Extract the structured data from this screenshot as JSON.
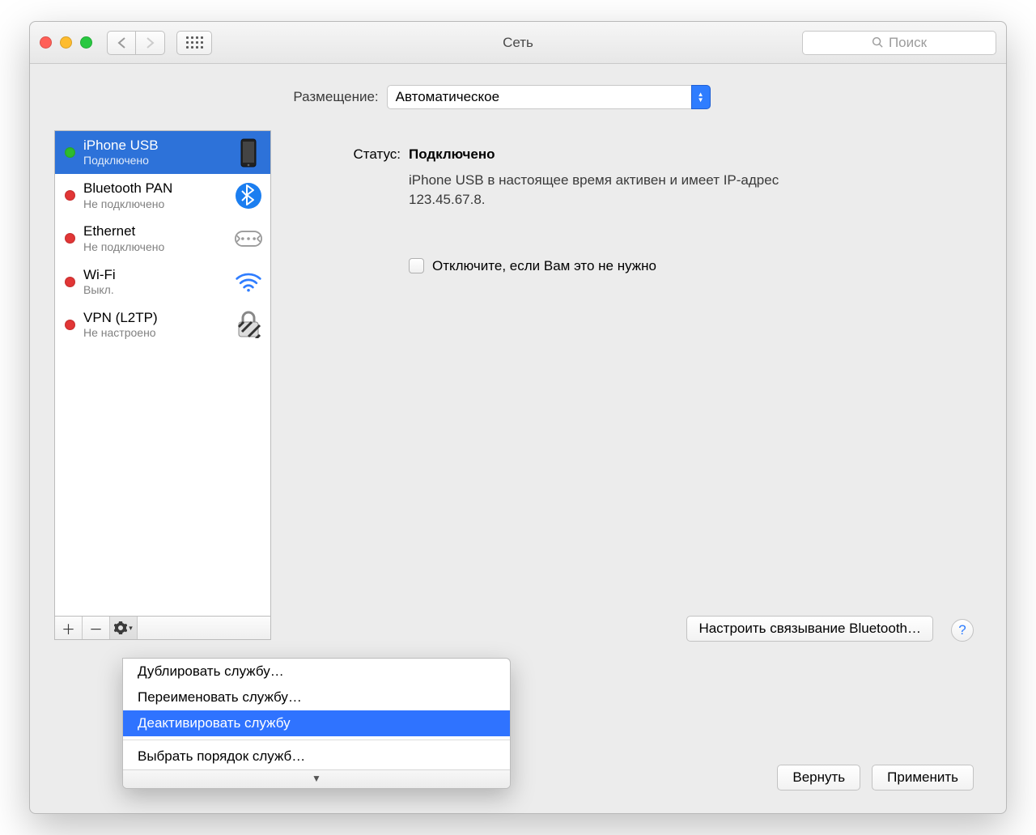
{
  "window": {
    "title": "Сеть"
  },
  "search": {
    "placeholder": "Поиск"
  },
  "location": {
    "label": "Размещение:",
    "value": "Автоматическое"
  },
  "services": [
    {
      "name": "iPhone USB",
      "status": "Подключено",
      "dot": "green",
      "icon": "iphone-icon",
      "selected": true
    },
    {
      "name": "Bluetooth PAN",
      "status": "Не подключено",
      "dot": "red",
      "icon": "bluetooth-icon"
    },
    {
      "name": "Ethernet",
      "status": "Не подключено",
      "dot": "red",
      "icon": "ethernet-icon"
    },
    {
      "name": "Wi-Fi",
      "status": "Выкл.",
      "dot": "red",
      "icon": "wifi-icon"
    },
    {
      "name": "VPN (L2TP)",
      "status": "Не настроено",
      "dot": "red",
      "icon": "vpn-icon"
    }
  ],
  "detail": {
    "status_label": "Статус:",
    "status_value": "Подключено",
    "status_desc": "iPhone USB  в настоящее время активен и имеет IP-адрес 123.45.67.8.",
    "checkbox_label": "Отключите, если Вам это не нужно",
    "configure_btn": "Настроить связывание Bluetooth…",
    "help": "?"
  },
  "footer": {
    "revert": "Вернуть",
    "apply": "Применить"
  },
  "gear_menu": {
    "items": [
      "Дублировать службу…",
      "Переименовать службу…",
      "Деактивировать службу"
    ],
    "after_div": "Выбрать порядок служб…",
    "selected_index": 2
  },
  "icons": {
    "iphone": "📱",
    "bluetooth": "bt",
    "ethernet": "eth",
    "wifi": "wifi",
    "vpn": "lock"
  }
}
